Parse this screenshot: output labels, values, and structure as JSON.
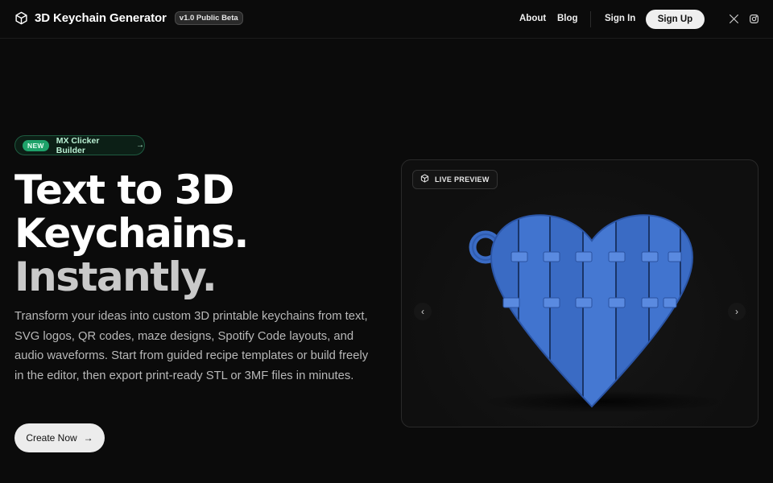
{
  "nav": {
    "brand": "3D Keychain Generator",
    "version": "v1.0 Public Beta",
    "links": [
      "About",
      "Blog"
    ],
    "sign_in": "Sign In",
    "sign_up": "Sign Up",
    "social_icons": [
      "x-icon",
      "instagram-icon"
    ]
  },
  "hero": {
    "badge_new": "NEW",
    "badge_label": "MX Clicker Builder",
    "headline_line1": "Text to 3D",
    "headline_line2": "Keychains.",
    "headline_line3": "Instantly.",
    "description": "Transform your ideas into custom 3D printable keychains from text, SVG logos, QR codes, maze designs, Spotify Code layouts, and audio waveforms. Start from guided recipe templates or build freely in the editor, then export print-ready STL or 3MF files in minutes.",
    "cta_label": "Create Now"
  },
  "preview": {
    "tag": "LIVE PREVIEW",
    "model_color": "#3a6bc4"
  },
  "colors": {
    "accent_green": "#1ea26a",
    "background": "#0b0b0b"
  }
}
